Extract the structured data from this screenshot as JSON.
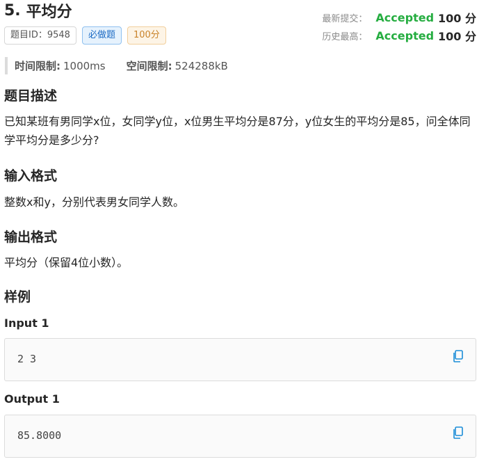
{
  "problem": {
    "number": "5.",
    "title": "平均分",
    "id_tag": "题目ID：9548",
    "difficulty_tag": "必做题",
    "score_tag": "100分"
  },
  "status": {
    "latest_label": "最新提交：",
    "latest_result": "Accepted",
    "latest_score": "100 分",
    "best_label": "历史最高：",
    "best_result": "Accepted",
    "best_score": "100 分"
  },
  "limits": {
    "time_label": "时间限制:",
    "time_value": "1000ms",
    "memory_label": "空间限制:",
    "memory_value": "524288kB"
  },
  "sections": {
    "description_title": "题目描述",
    "description_text": "已知某班有男同学x位，女同学y位，x位男生平均分是87分，y位女生的平均分是85，问全体同学平均分是多少分?",
    "input_title": "输入格式",
    "input_text": "整数x和y，分别代表男女同学人数。",
    "output_title": "输出格式",
    "output_text": "平均分（保留4位小数）。",
    "samples_title": "样例"
  },
  "samples": {
    "input_label": "Input 1",
    "input_value": "2 3",
    "output_label": "Output 1",
    "output_value": "85.8000"
  },
  "colors": {
    "accepted": "#25ad40",
    "copy_icon": "#1a8cd8"
  },
  "icons": {
    "copy": "copy-icon"
  }
}
